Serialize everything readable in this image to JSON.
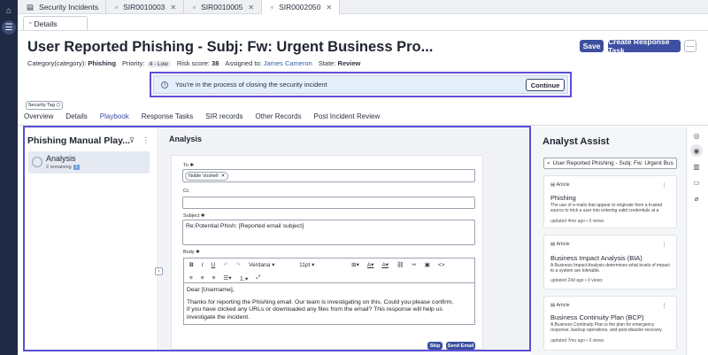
{
  "rail": {
    "home_icon": "home-icon",
    "menu_icon": "menu-icon"
  },
  "top_tabs": [
    {
      "label": "Security Incidents",
      "icon": "list-icon"
    },
    {
      "label": "SIR0010003"
    },
    {
      "label": "SIR0010005"
    },
    {
      "label": "SIR0002050",
      "active": true
    }
  ],
  "sub_tab": {
    "label": "Details"
  },
  "record": {
    "title": "User Reported Phishing - Subj: Fw: Urgent Business Pro...",
    "category_label": "Category(category):",
    "category_value": "Phishing",
    "priority_label": "Priority:",
    "priority_value": "4 - Low",
    "risk_label": "Risk score:",
    "risk_value": "38",
    "assigned_label": "Assigned to:",
    "assigned_value": "James Cameron",
    "state_label": "State:",
    "state_value": "Review"
  },
  "header_buttons": {
    "save": "Save",
    "create_task": "Create Response Task",
    "more": "···"
  },
  "banner": {
    "text": "You're in the process of closing the security incident",
    "button": "Continue"
  },
  "security_tag": "Security Tag",
  "content_tabs": [
    {
      "label": "Overview"
    },
    {
      "label": "Details"
    },
    {
      "label": "Playbook",
      "active": true
    },
    {
      "label": "Response Tasks"
    },
    {
      "label": "SIR records"
    },
    {
      "label": "Other Records"
    },
    {
      "label": "Post Incident Review"
    }
  ],
  "playbook": {
    "title": "Phishing Manual Play...",
    "task_title": "Analysis",
    "task_sub": "2 remaining",
    "task_badge": "1"
  },
  "analysis": {
    "title": "Analysis",
    "to_label": "To ✱",
    "to_chip": "Noble Voshell",
    "cc_label": "Cc",
    "subject_label": "Subject ✱",
    "subject_value": "Re:Potential Phish: [Reported email subject]",
    "body_label": "Body ✱",
    "font_select": "Verdana",
    "size_select": "11pt",
    "body_line1": "Dear [Username],",
    "body_line2": "Thanks for reporting the Phishing email. Our team is investigating on this. Could you please confirm,",
    "body_line3": "if you have clicked any URLs or downloaded any files from the email? This response will help us",
    "body_line4": "investigate the incident.",
    "skip": "Skip",
    "send": "Send Email"
  },
  "assist": {
    "title": "Analyst Assist",
    "search_value": "User Reported Phishing - Subj: Fw: Urgent Bus",
    "cards": [
      {
        "type": "Article",
        "title": "Phishing",
        "desc": "The use of e-mails that appear to originate from a trusted source to trick a user into entering valid credentials at a",
        "foot": "updated 4mo ago • 0 views"
      },
      {
        "type": "Article",
        "title": "Business Impact Analysis (BIA)",
        "desc": "A Business Impact Analysis determines what levels of impact to a system are tolerable.",
        "foot": "updated 24d ago • 0 views"
      },
      {
        "type": "Article",
        "title": "Business Continuity Plan (BCP)",
        "desc": "A Business Continuity Plan is the plan for emergency response, backup operations, and post-disaster recovery",
        "foot": "updated 7mo ago • 0 views"
      }
    ]
  },
  "colors": {
    "primary": "#3c4fa0",
    "highlight": "#5b4fd6",
    "rail": "#1f2a44"
  }
}
